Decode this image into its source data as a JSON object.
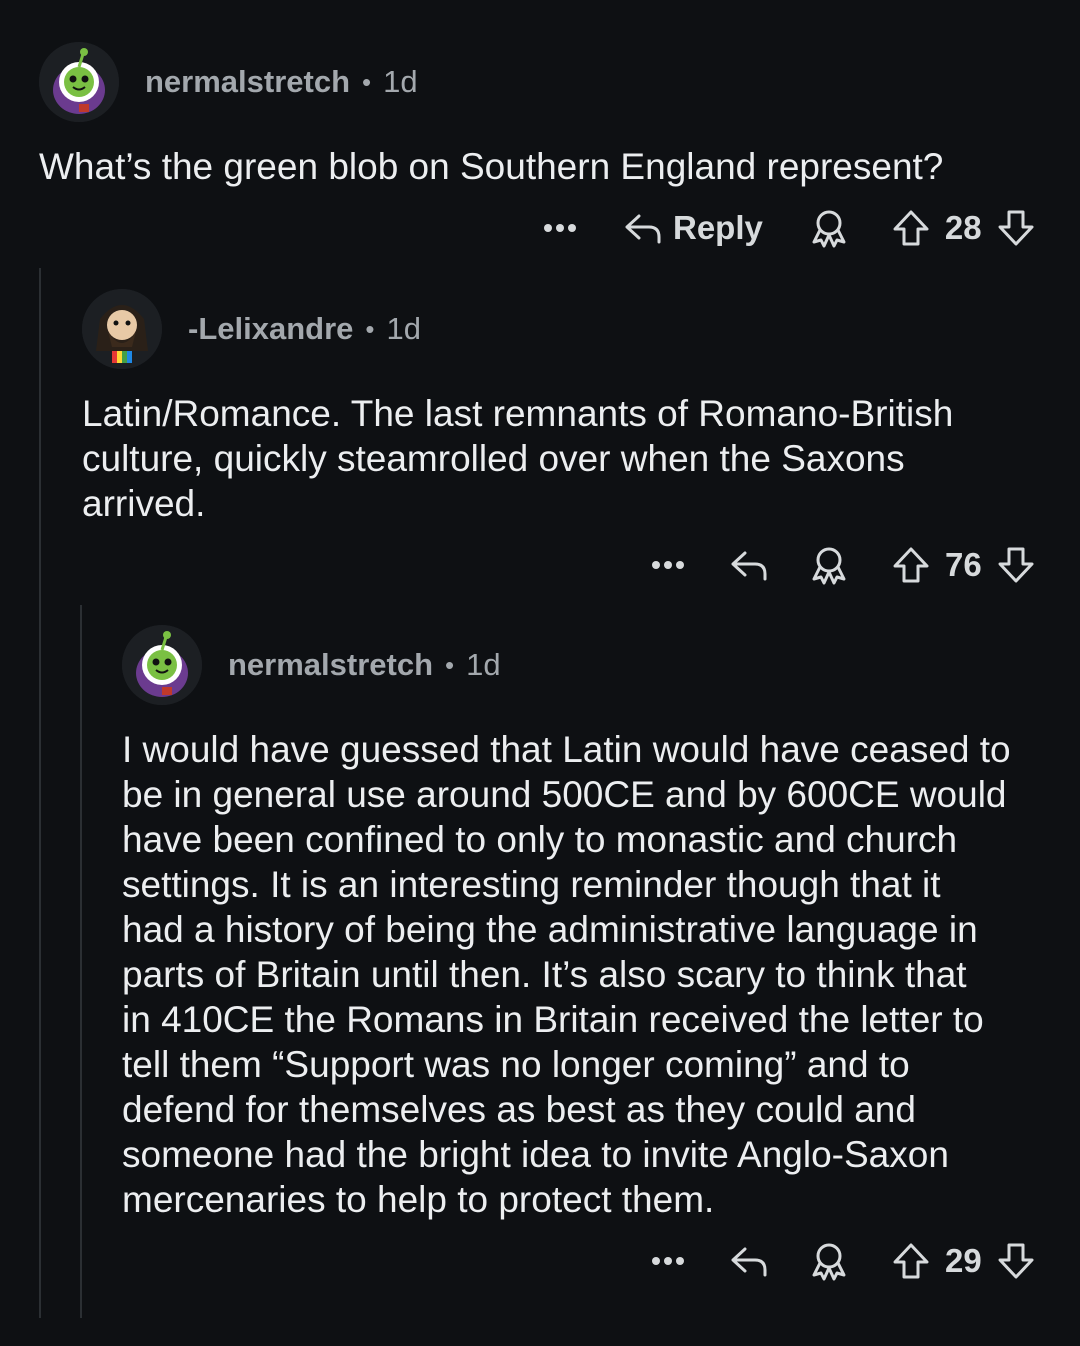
{
  "comments": [
    {
      "username": "nermalstretch",
      "separator": "•",
      "time": "1d",
      "text": "What’s the green blob on Southern England represent?",
      "reply_label": "Reply",
      "score": "28"
    },
    {
      "username": "-Lelixandre",
      "separator": "•",
      "time": "1d",
      "text": "Latin/Romance. The last remnants of Romano-British\nculture, quickly steamrolled over when the Saxons\narrived.",
      "score": "76"
    },
    {
      "username": "nermalstretch",
      "separator": "•",
      "time": "1d",
      "text": "I would have guessed that Latin would have ceased to\nbe in general use around 500CE and by 600CE would\nhave been confined to only to monastic and church\nsettings. It is an interesting reminder though that it\nhad a history of being the administrative language in\nparts of Britain until then. It’s also scary to think that\nin 410CE the Romans in Britain received the letter to\ntell them “Support was no longer coming” and to\ndefend for themselves as best as they could and\nsomeone had the bright idea to invite Anglo-Saxon\nmercenaries to help to protect them.",
      "score": "29"
    }
  ],
  "icons": {
    "more": "more-options-icon",
    "reply": "reply-arrow-icon",
    "award": "award-icon",
    "upvote": "upvote-arrow-icon",
    "downvote": "downvote-arrow-icon"
  },
  "colors": {
    "background": "#0e1013",
    "text": "#eceef0",
    "meta": "#a3a8ad",
    "thread_line": "#2b2f33"
  }
}
